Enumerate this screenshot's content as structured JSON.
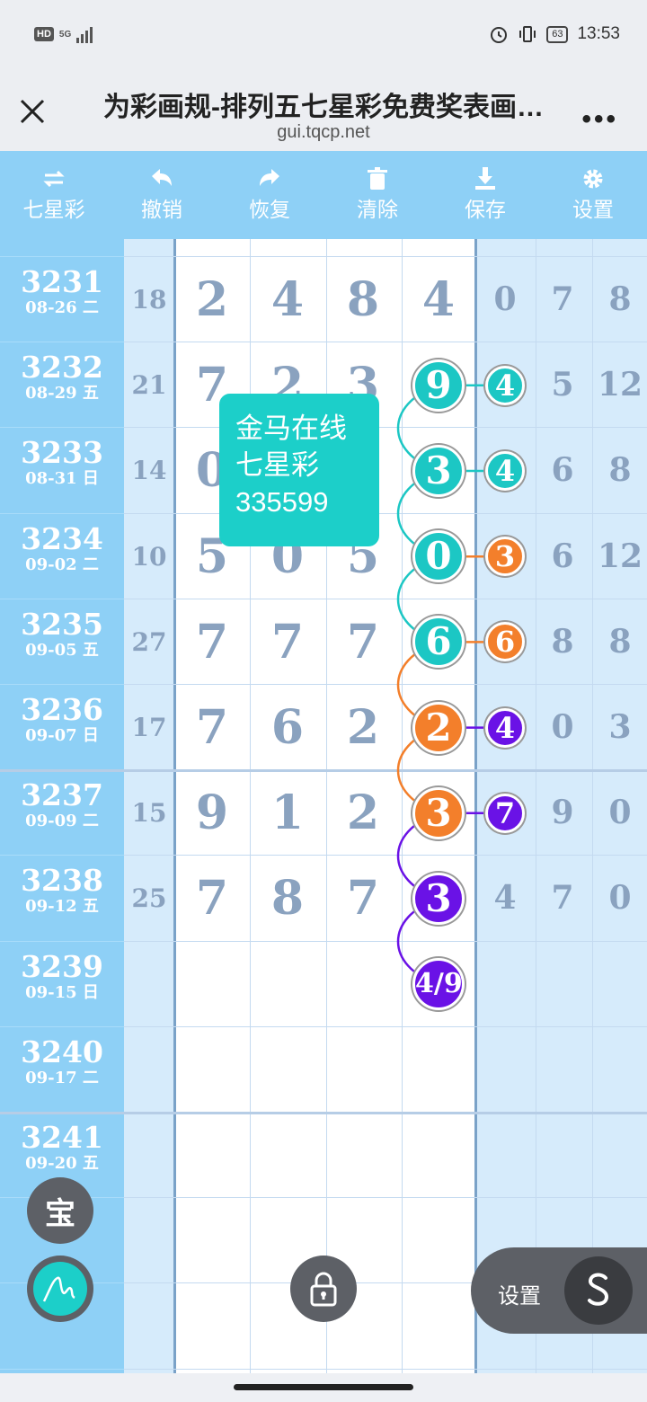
{
  "status_bar": {
    "hd": "HD",
    "network": "5G",
    "battery": "63",
    "time": "13:53"
  },
  "browser": {
    "title": "为彩画规-排列五七星彩免费奖表画…",
    "url": "gui.tqcp.net"
  },
  "toolbar": {
    "items": [
      {
        "label": "七星彩",
        "icon": "swap-icon"
      },
      {
        "label": "撤销",
        "icon": "undo-icon"
      },
      {
        "label": "恢复",
        "icon": "redo-icon"
      },
      {
        "label": "清除",
        "icon": "trash-icon"
      },
      {
        "label": "保存",
        "icon": "download-icon"
      },
      {
        "label": "设置",
        "icon": "gear-icon"
      }
    ]
  },
  "rows": [
    {
      "issue": "3231",
      "date": "08-26 二",
      "sum": "18",
      "d1": "2",
      "d2": "4",
      "d3": "8",
      "d4": "4",
      "r1": "0",
      "r2": "7",
      "r3": "8"
    },
    {
      "issue": "3232",
      "date": "08-29 五",
      "sum": "21",
      "d1": "7",
      "d2": "2",
      "d3": "3",
      "d4": "",
      "r1": "",
      "r2": "5",
      "r3": "12"
    },
    {
      "issue": "3233",
      "date": "08-31 日",
      "sum": "14",
      "d1": "0",
      "d2": "",
      "d3": "",
      "d4": "",
      "r1": "",
      "r2": "6",
      "r3": "8"
    },
    {
      "issue": "3234",
      "date": "09-02 二",
      "sum": "10",
      "d1": "5",
      "d2": "0",
      "d3": "5",
      "d4": "",
      "r1": "",
      "r2": "6",
      "r3": "12"
    },
    {
      "issue": "3235",
      "date": "09-05 五",
      "sum": "27",
      "d1": "7",
      "d2": "7",
      "d3": "7",
      "d4": "",
      "r1": "",
      "r2": "8",
      "r3": "8"
    },
    {
      "issue": "3236",
      "date": "09-07 日",
      "sum": "17",
      "d1": "7",
      "d2": "6",
      "d3": "2",
      "d4": "",
      "r1": "",
      "r2": "0",
      "r3": "3"
    },
    {
      "issue": "3237",
      "date": "09-09 二",
      "sum": "15",
      "d1": "9",
      "d2": "1",
      "d3": "2",
      "d4": "",
      "r1": "",
      "r2": "9",
      "r3": "0"
    },
    {
      "issue": "3238",
      "date": "09-12 五",
      "sum": "25",
      "d1": "7",
      "d2": "8",
      "d3": "7",
      "d4": "",
      "r1": "4",
      "r2": "7",
      "r3": "0"
    },
    {
      "issue": "3239",
      "date": "09-15 日",
      "sum": "",
      "d1": "",
      "d2": "",
      "d3": "",
      "d4": "",
      "r1": "",
      "r2": "",
      "r3": ""
    },
    {
      "issue": "3240",
      "date": "09-17 二",
      "sum": "",
      "d1": "",
      "d2": "",
      "d3": "",
      "d4": "",
      "r1": "",
      "r2": "",
      "r3": ""
    },
    {
      "issue": "3241",
      "date": "09-20 五",
      "sum": "",
      "d1": "",
      "d2": "",
      "d3": "",
      "d4": "",
      "r1": "",
      "r2": "",
      "r3": ""
    }
  ],
  "balls": {
    "big": [
      {
        "row": 1,
        "text": "9",
        "color": "#1cc7c4"
      },
      {
        "row": 2,
        "text": "3",
        "color": "#1cc7c4"
      },
      {
        "row": 3,
        "text": "0",
        "color": "#1cc7c4"
      },
      {
        "row": 4,
        "text": "6",
        "color": "#1cc7c4"
      },
      {
        "row": 5,
        "text": "2",
        "color": "#f37f2b"
      },
      {
        "row": 6,
        "text": "3",
        "color": "#f37f2b"
      },
      {
        "row": 7,
        "text": "3",
        "color": "#6a12e6"
      },
      {
        "row": 8,
        "text": "4/9",
        "color": "#6a12e6"
      }
    ],
    "small": [
      {
        "row": 1,
        "text": "4",
        "color": "#1cc7c4"
      },
      {
        "row": 2,
        "text": "4",
        "color": "#1cc7c4"
      },
      {
        "row": 3,
        "text": "3",
        "color": "#f37f2b"
      },
      {
        "row": 4,
        "text": "6",
        "color": "#f37f2b"
      },
      {
        "row": 5,
        "text": "4",
        "color": "#6a12e6"
      },
      {
        "row": 6,
        "text": "7",
        "color": "#6a12e6"
      }
    ]
  },
  "tooltip": {
    "line1": "金马在线",
    "line2": "七星彩",
    "line3": "335599"
  },
  "fabs": {
    "bao": "宝",
    "settings_label": "设置"
  }
}
